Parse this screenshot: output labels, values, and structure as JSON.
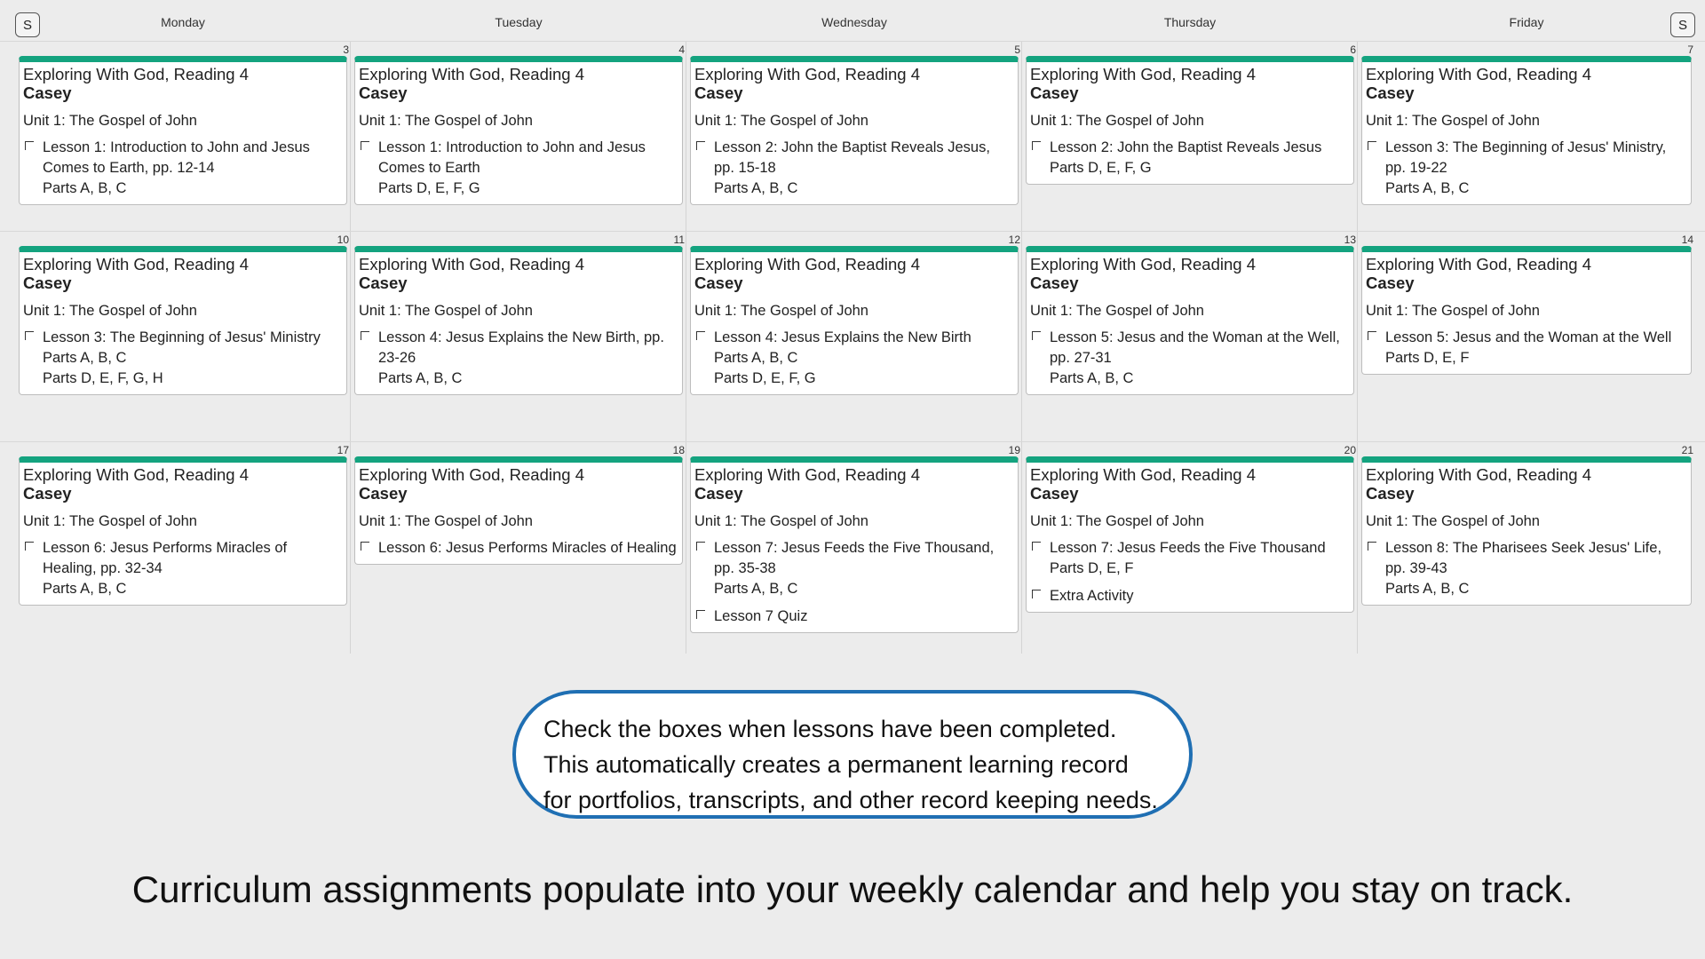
{
  "header": {
    "prev_button": "S",
    "next_button": "S",
    "days": [
      "Monday",
      "Tuesday",
      "Wednesday",
      "Thursday",
      "Friday"
    ]
  },
  "weeks": [
    [
      {
        "date": "3",
        "title": "Exploring With God, Reading 4",
        "student": "Casey",
        "unit": "Unit 1: The Gospel of John",
        "tasks": [
          {
            "text": "Lesson 1: Introduction to John and Jesus Comes to Earth, pp. 12-14",
            "parts": [
              "Parts A, B, C"
            ]
          }
        ]
      },
      {
        "date": "4",
        "title": "Exploring With God, Reading 4",
        "student": "Casey",
        "unit": "Unit 1: The Gospel of John",
        "tasks": [
          {
            "text": "Lesson 1: Introduction to John and Jesus Comes to Earth",
            "parts": [
              "Parts D, E, F, G"
            ]
          }
        ]
      },
      {
        "date": "5",
        "title": "Exploring With God, Reading 4",
        "student": "Casey",
        "unit": "Unit 1: The Gospel of John",
        "tasks": [
          {
            "text": "Lesson 2: John the Baptist Reveals Jesus, pp. 15-18",
            "parts": [
              "Parts A, B, C"
            ]
          }
        ]
      },
      {
        "date": "6",
        "title": "Exploring With God, Reading 4",
        "student": "Casey",
        "unit": "Unit 1: The Gospel of John",
        "tasks": [
          {
            "text": "Lesson 2: John the Baptist Reveals Jesus",
            "parts": [
              "Parts D, E, F, G"
            ]
          }
        ]
      },
      {
        "date": "7",
        "title": "Exploring With God, Reading 4",
        "student": "Casey",
        "unit": "Unit 1: The Gospel of John",
        "tasks": [
          {
            "text": "Lesson 3: The Beginning of Jesus' Ministry, pp. 19-22",
            "parts": [
              "Parts A, B, C"
            ]
          }
        ]
      }
    ],
    [
      {
        "date": "10",
        "title": "Exploring With God, Reading 4",
        "student": "Casey",
        "unit": "Unit 1: The Gospel of John",
        "tasks": [
          {
            "text": "Lesson 3: The Beginning of Jesus' Ministry",
            "parts": [
              "Parts A, B, C",
              "Parts D, E, F, G, H"
            ]
          }
        ]
      },
      {
        "date": "11",
        "title": "Exploring With God, Reading 4",
        "student": "Casey",
        "unit": "Unit 1: The Gospel of John",
        "tasks": [
          {
            "text": "Lesson 4: Jesus Explains the New Birth, pp. 23-26",
            "parts": [
              "Parts A, B, C"
            ]
          }
        ]
      },
      {
        "date": "12",
        "title": "Exploring With God, Reading 4",
        "student": "Casey",
        "unit": "Unit 1: The Gospel of John",
        "tasks": [
          {
            "text": "Lesson 4: Jesus Explains the New Birth",
            "parts": [
              "Parts A, B, C",
              "Parts D, E, F, G"
            ]
          }
        ]
      },
      {
        "date": "13",
        "title": "Exploring With God, Reading 4",
        "student": "Casey",
        "unit": "Unit 1: The Gospel of John",
        "tasks": [
          {
            "text": "Lesson 5: Jesus and the Woman at the Well, pp. 27-31",
            "parts": [
              "Parts A, B, C"
            ]
          }
        ]
      },
      {
        "date": "14",
        "title": "Exploring With God, Reading 4",
        "student": "Casey",
        "unit": "Unit 1: The Gospel of John",
        "tasks": [
          {
            "text": "Lesson 5: Jesus and the Woman at the Well",
            "parts": [
              "Parts D, E, F"
            ]
          }
        ]
      }
    ],
    [
      {
        "date": "17",
        "title": "Exploring With God, Reading 4",
        "student": "Casey",
        "unit": "Unit 1: The Gospel of John",
        "tasks": [
          {
            "text": "Lesson 6: Jesus Performs Miracles of Healing, pp. 32-34",
            "parts": [
              "Parts A, B, C"
            ]
          }
        ]
      },
      {
        "date": "18",
        "title": "Exploring With God, Reading 4",
        "student": "Casey",
        "unit": "Unit 1: The Gospel of John",
        "tasks": [
          {
            "text": "Lesson 6: Jesus Performs Miracles of Healing",
            "parts": []
          }
        ]
      },
      {
        "date": "19",
        "title": "Exploring With God, Reading 4",
        "student": "Casey",
        "unit": "Unit 1: The Gospel of John",
        "tasks": [
          {
            "text": "Lesson 7: Jesus Feeds the Five Thousand, pp. 35-38",
            "parts": [
              "Parts A, B, C"
            ]
          },
          {
            "text": "Lesson 7 Quiz",
            "parts": []
          }
        ]
      },
      {
        "date": "20",
        "title": "Exploring With God, Reading 4",
        "student": "Casey",
        "unit": "Unit 1: The Gospel of John",
        "tasks": [
          {
            "text": "Lesson 7: Jesus Feeds the Five Thousand",
            "parts": [
              "Parts D, E, F"
            ]
          },
          {
            "text": "Extra Activity",
            "parts": []
          }
        ]
      },
      {
        "date": "21",
        "title": "Exploring With God, Reading 4",
        "student": "Casey",
        "unit": "Unit 1: The Gospel of John",
        "tasks": [
          {
            "text": "Lesson 8: The Pharisees Seek Jesus' Life, pp. 39-43",
            "parts": [
              "Parts A, B, C"
            ]
          }
        ]
      }
    ]
  ],
  "callout": {
    "lines": [
      "Check the boxes when lessons have been completed.",
      "This automatically creates a permanent learning record",
      "for portfolios, transcripts, and other record keeping needs."
    ]
  },
  "tagline": "Curriculum assignments populate into your weekly calendar and help you stay on track.",
  "colors": {
    "accent": "#14a37f",
    "callout_border": "#1f6fb3",
    "background": "#ececec"
  }
}
